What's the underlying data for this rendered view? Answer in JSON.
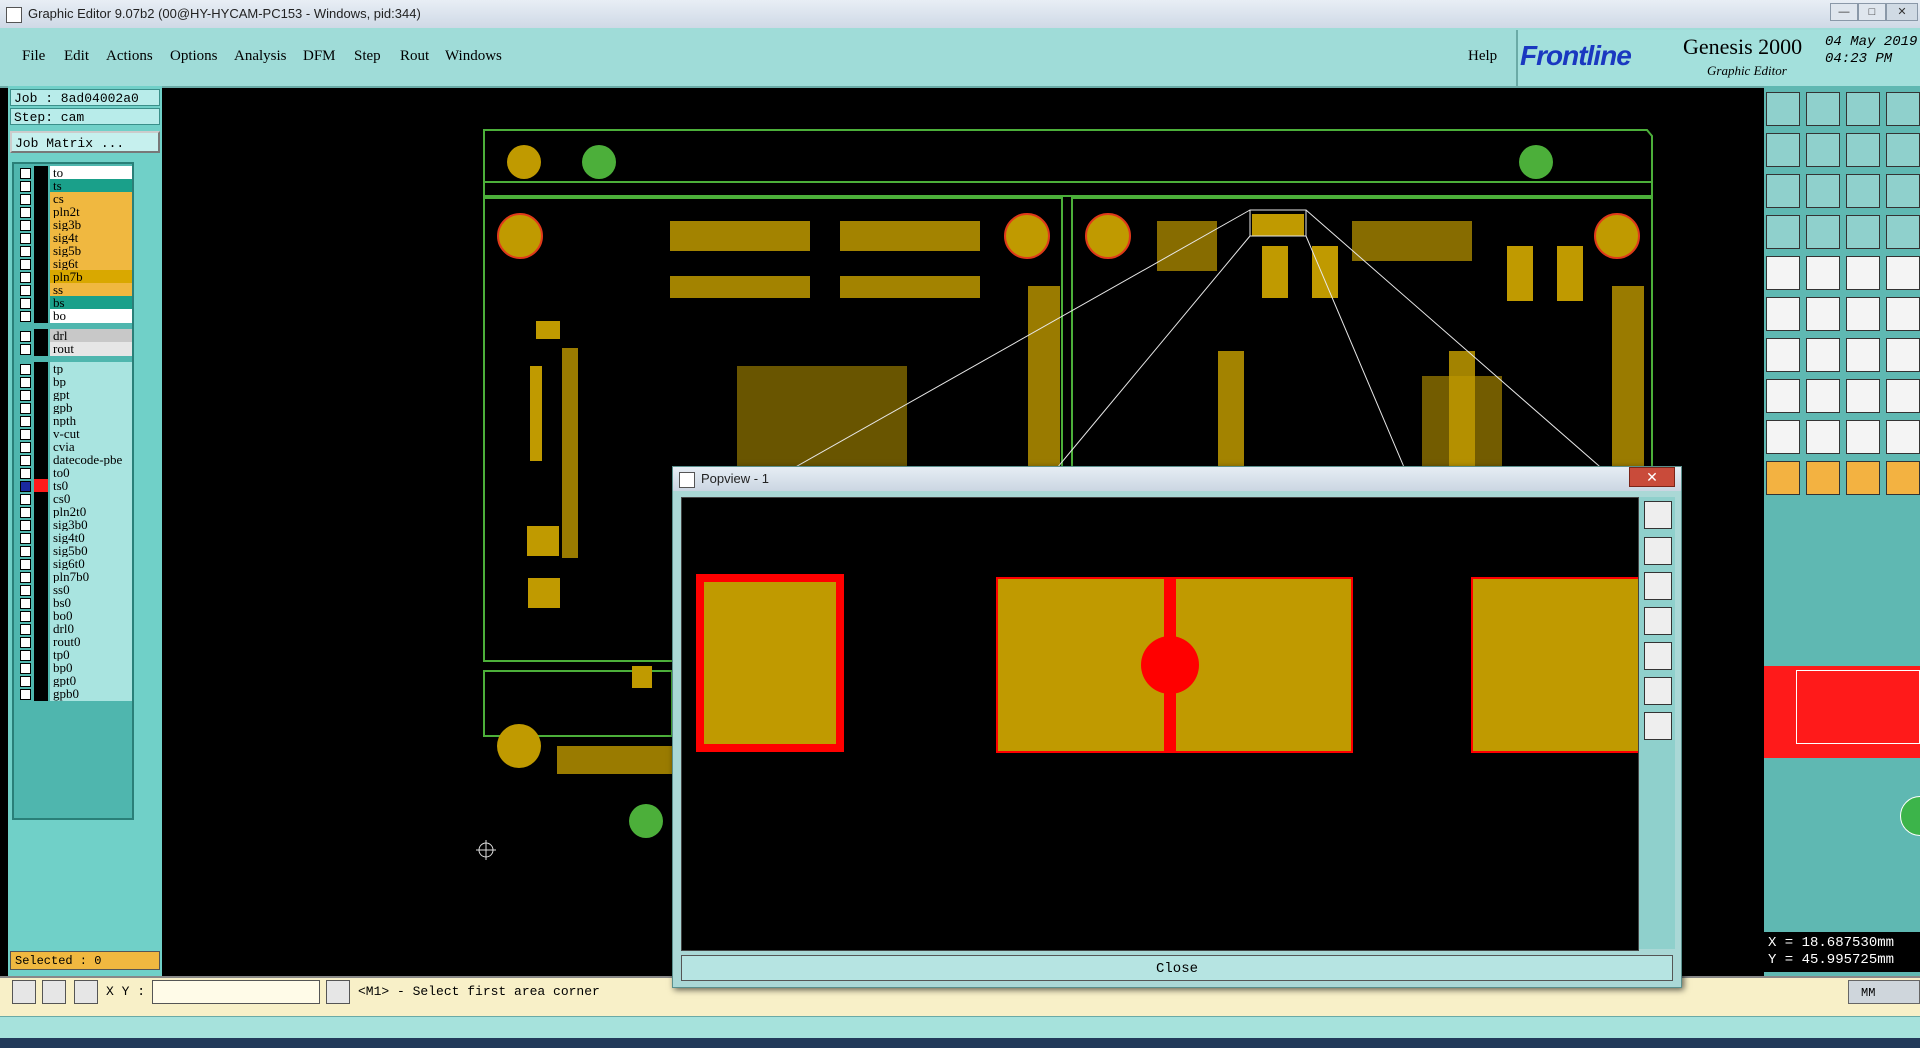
{
  "window": {
    "title": "Graphic Editor 9.07b2 (00@HY-HYCAM-PC153 - Windows, pid:344)",
    "minimize": "—",
    "maximize": "□",
    "close": "✕"
  },
  "menu": {
    "items": [
      "File",
      "Edit",
      "Actions",
      "Options",
      "Analysis",
      "DFM",
      "Step",
      "Rout",
      "Windows"
    ],
    "help": "Help"
  },
  "logo": {
    "brand": "Frontline",
    "product": "Genesis 2000",
    "subtitle": "Graphic Editor",
    "date": "04 May 2019",
    "time": "04:23 PM"
  },
  "job": {
    "job_label": "Job : 8ad04002a0",
    "step_label": "Step: cam",
    "matrix_button": "Job Matrix ..."
  },
  "layers": [
    {
      "name": "to",
      "color": "#ffffff"
    },
    {
      "name": "ts",
      "color": "#1aa08a"
    },
    {
      "name": "cs",
      "color": "#f0b840"
    },
    {
      "name": "pln2t",
      "color": "#f0b840"
    },
    {
      "name": "sig3b",
      "color": "#f0b840"
    },
    {
      "name": "sig4t",
      "color": "#f0b840"
    },
    {
      "name": "sig5b",
      "color": "#f0b840"
    },
    {
      "name": "sig6t",
      "color": "#f0b840"
    },
    {
      "name": "pln7b",
      "color": "#d9a800"
    },
    {
      "name": "ss",
      "color": "#f0b840"
    },
    {
      "name": "bs",
      "color": "#1aa08a"
    },
    {
      "name": "bo",
      "color": "#ffffff"
    }
  ],
  "drill_layers": [
    {
      "name": "drl",
      "color": "#c8c8c8"
    },
    {
      "name": "rout",
      "color": "#e6e6e6"
    }
  ],
  "misc_layers": [
    {
      "name": "tp"
    },
    {
      "name": "bp"
    },
    {
      "name": "gpt"
    },
    {
      "name": "gpb"
    },
    {
      "name": "npth"
    },
    {
      "name": "v-cut"
    },
    {
      "name": "cvia"
    },
    {
      "name": "datecode-pbe"
    },
    {
      "name": "to0"
    },
    {
      "name": "ts0",
      "work": true
    },
    {
      "name": "cs0"
    },
    {
      "name": "pln2t0"
    },
    {
      "name": "sig3b0"
    },
    {
      "name": "sig4t0"
    },
    {
      "name": "sig5b0"
    },
    {
      "name": "sig6t0"
    },
    {
      "name": "pln7b0"
    },
    {
      "name": "ss0"
    },
    {
      "name": "bs0"
    },
    {
      "name": "bo0"
    },
    {
      "name": "drl0"
    },
    {
      "name": "rout0"
    },
    {
      "name": "tp0"
    },
    {
      "name": "bp0"
    },
    {
      "name": "gpt0"
    },
    {
      "name": "gpb0"
    }
  ],
  "selected": "Selected : 0",
  "status": {
    "xy_label": "X Y :",
    "xy_value": "",
    "message": "<M1> - Select first area corner",
    "units": "MM"
  },
  "coords": {
    "x": "X = 18.687530mm",
    "y": "Y = 45.995725mm"
  },
  "popview": {
    "title": "Popview - 1",
    "close_button": "Close"
  },
  "colors": {
    "copper": "#c09a00",
    "highlight": "#ff0000",
    "outline": "#4caf3a",
    "panel": "#9fdcd8"
  }
}
